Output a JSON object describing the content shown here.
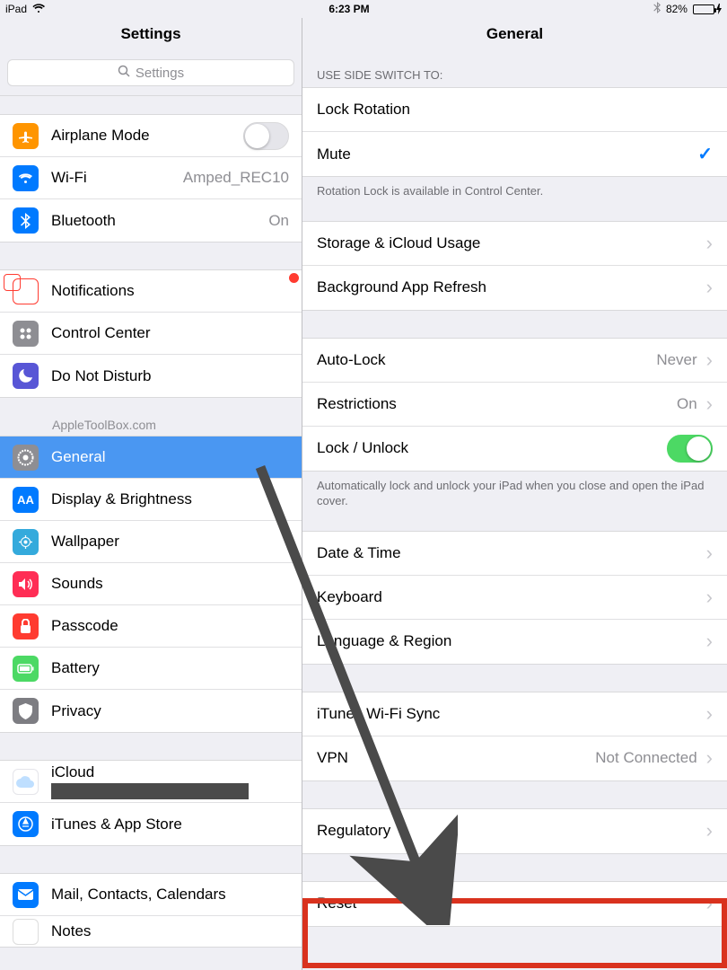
{
  "status": {
    "device": "iPad",
    "time": "6:23 PM",
    "battery_pct": "82%"
  },
  "left": {
    "title": "Settings",
    "search_placeholder": "Settings",
    "watermark": "AppleToolBox.com",
    "groups": {
      "network": {
        "airplane": "Airplane Mode",
        "wifi": "Wi-Fi",
        "wifi_value": "Amped_REC10",
        "bluetooth": "Bluetooth",
        "bluetooth_value": "On"
      },
      "notifs": {
        "notifications": "Notifications",
        "control_center": "Control Center",
        "dnd": "Do Not Disturb"
      },
      "general": {
        "general": "General",
        "display": "Display & Brightness",
        "wallpaper": "Wallpaper",
        "sounds": "Sounds",
        "passcode": "Passcode",
        "battery": "Battery",
        "privacy": "Privacy"
      },
      "cloud": {
        "icloud": "iCloud",
        "itunes": "iTunes & App Store"
      },
      "apps": {
        "mail": "Mail, Contacts, Calendars",
        "notes": "Notes"
      }
    }
  },
  "right": {
    "title": "General",
    "side_switch_header": "Use Side Switch to:",
    "lock_rotation": "Lock Rotation",
    "mute": "Mute",
    "side_switch_footer": "Rotation Lock is available in Control Center.",
    "storage": "Storage & iCloud Usage",
    "bg_refresh": "Background App Refresh",
    "auto_lock": "Auto-Lock",
    "auto_lock_value": "Never",
    "restrictions": "Restrictions",
    "restrictions_value": "On",
    "lock_unlock": "Lock / Unlock",
    "lock_unlock_footer": "Automatically lock and unlock your iPad when you close and open the iPad cover.",
    "date_time": "Date & Time",
    "keyboard": "Keyboard",
    "language": "Language & Region",
    "itunes_sync": "iTunes Wi-Fi Sync",
    "vpn": "VPN",
    "vpn_value": "Not Connected",
    "regulatory": "Regulatory",
    "reset": "Reset"
  }
}
